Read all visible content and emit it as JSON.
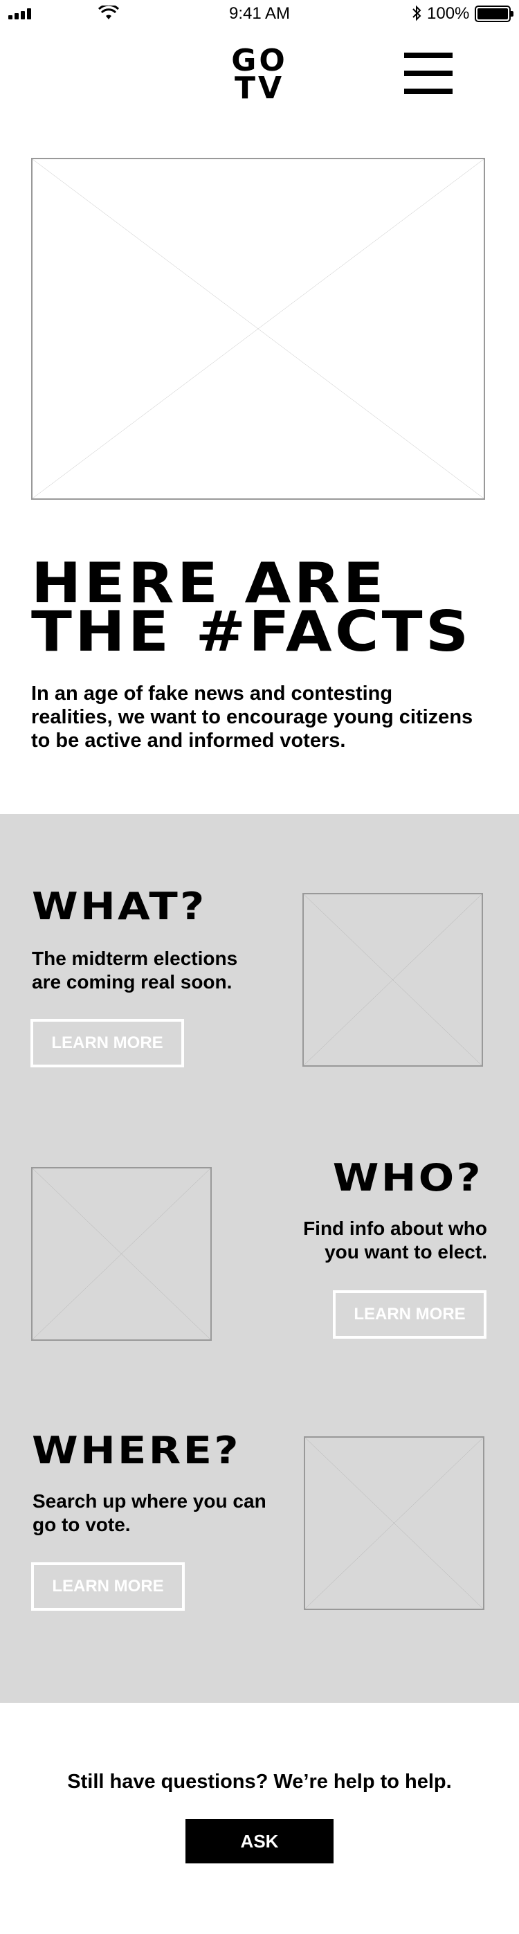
{
  "status_bar": {
    "time": "9:41 AM",
    "battery_percent": "100%",
    "icons": [
      "signal-icon",
      "wifi-icon",
      "bluetooth-icon",
      "battery-icon"
    ]
  },
  "header": {
    "logo_line1": "GO",
    "logo_line2": "TV",
    "menu_icon": "hamburger-menu-icon"
  },
  "hero": {
    "title_line1": "HERE ARE",
    "title_line2": "THE #FACTS",
    "description": "In an age of fake news and contesting realities, we want to encourage young citizens to be active and informed voters."
  },
  "sections": [
    {
      "title": "WHAT?",
      "text": "The midterm elections are coming real soon.",
      "button": "LEARN MORE"
    },
    {
      "title": "WHO?",
      "text": "Find info about who you want to elect.",
      "button": "LEARN MORE"
    },
    {
      "title": "WHERE?",
      "text": "Search up where you can go to vote.",
      "button": "LEARN MORE"
    }
  ],
  "footer": {
    "question": "Still have questions? We’re help to help.",
    "ask_label": "ASK"
  },
  "colors": {
    "background": "#ffffff",
    "section_background": "#d8d8d8",
    "placeholder_stroke": "#999999",
    "button_outline": "#ffffff",
    "primary": "#000000"
  }
}
